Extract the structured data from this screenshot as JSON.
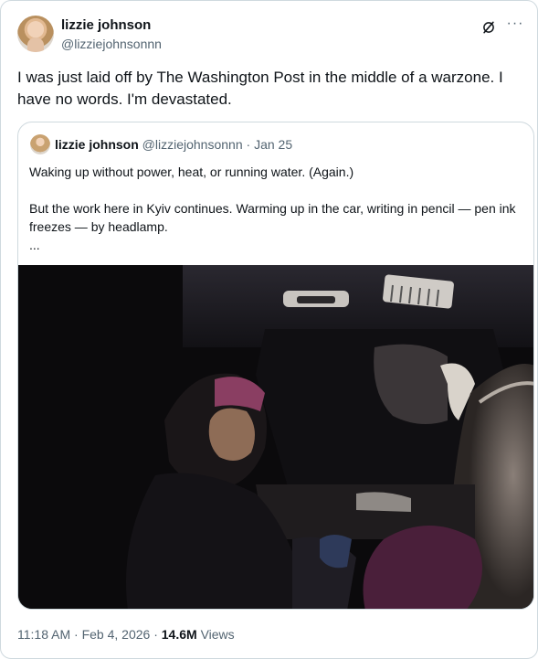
{
  "post": {
    "author_name": "lizzie johnson",
    "author_handle": "@lizziejohnsonnn",
    "text": "I was just laid off by The Washington Post in the middle of a warzone. I have no words. I'm devastated.",
    "more_label": "···"
  },
  "quoted": {
    "author_name": "lizzie johnson",
    "author_handle": "@lizziejohnsonnn",
    "separator": "·",
    "date": "Jan 25",
    "text": "Waking up without power, heat, or running water. (Again.)\n\nBut the work here in Kyiv continues. Warming up in the car, writing in pencil — pen ink freezes — by headlamp.\n..."
  },
  "footer": {
    "time": "11:18 AM",
    "sep1": "·",
    "date": "Feb 4, 2026",
    "sep2": "·",
    "views_count": "14.6M",
    "views_label": "Views"
  },
  "icons": {
    "brand": "x-logo-icon",
    "more": "more-options-icon"
  }
}
